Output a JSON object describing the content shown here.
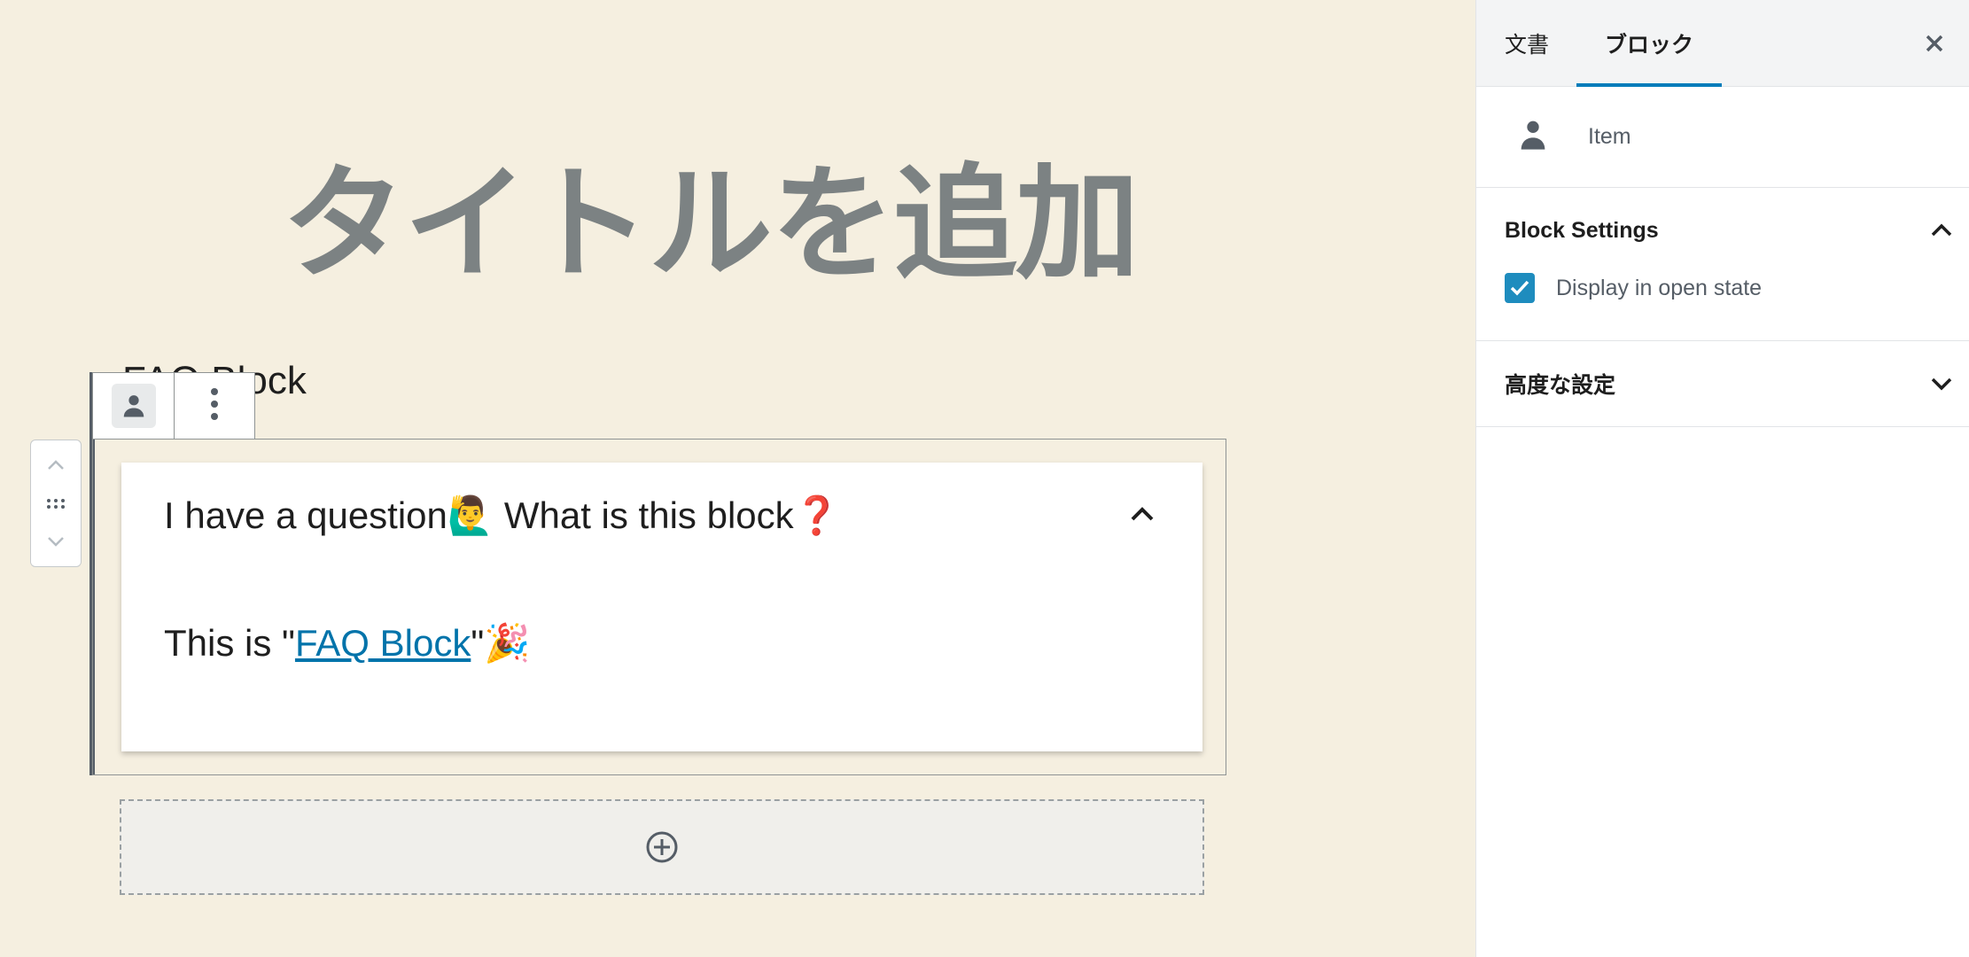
{
  "editor": {
    "post_title_placeholder": "タイトルを追加",
    "block_label": "FAQ Block",
    "faq": {
      "question": "I have a question🙋‍♂️ What is this block❓",
      "answer_prefix": "This is \"",
      "answer_link": "FAQ Block",
      "answer_suffix": "\"🎉"
    }
  },
  "sidebar": {
    "tabs": [
      "文書",
      "ブロック"
    ],
    "active_tab": "ブロック",
    "block_name": "Item",
    "panels": {
      "block_settings": {
        "title": "Block Settings",
        "checkbox_label": "Display in open state",
        "checked": true
      },
      "advanced": {
        "title": "高度な設定"
      }
    }
  },
  "colors": {
    "canvas_bg": "#f5efe0",
    "accent": "#007cba",
    "checkbox": "#1e8cbe",
    "title_placeholder": "#7c8283"
  }
}
